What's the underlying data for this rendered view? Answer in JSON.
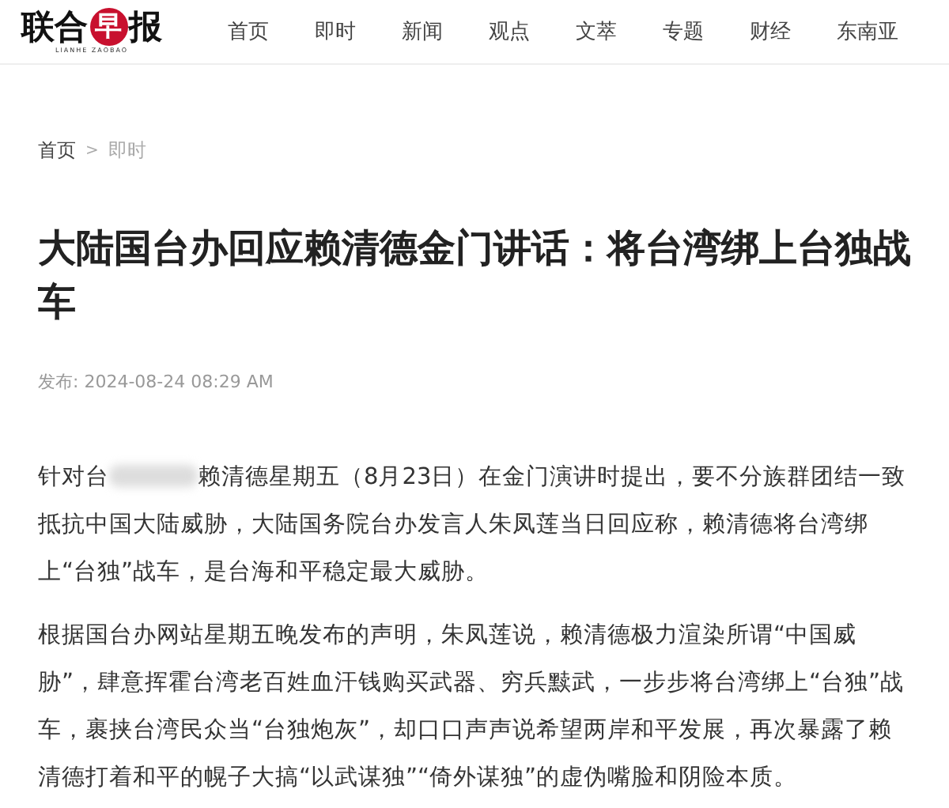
{
  "logo": {
    "chars": [
      "联",
      "合",
      "早",
      "报"
    ],
    "subtitle": "LIANHE ZAOBAO"
  },
  "nav": [
    {
      "label": "首页"
    },
    {
      "label": "即时"
    },
    {
      "label": "新闻"
    },
    {
      "label": "观点"
    },
    {
      "label": "文萃"
    },
    {
      "label": "专题"
    },
    {
      "label": "财经"
    },
    {
      "label": "东南亚"
    }
  ],
  "breadcrumb": [
    {
      "label": "首页",
      "current": false
    },
    {
      "label": "即时",
      "current": true
    }
  ],
  "breadcrumb_separator": ">",
  "title": "大陆国台办回应赖清德金门讲话：将台湾绑上台独战车",
  "published": "发布: 2024-08-24 08:29 AM",
  "paragraphs": [
    {
      "before_blur": "针对台",
      "after_blur": "赖清德星期五（8月23日）在金门演讲时提出，要不分族群团结一致抵抗中国大陆威胁，大陆国务院台办发言人朱凤莲当日回应称，赖清德将台湾绑上“台独”战车，是台海和平稳定最大威胁。"
    },
    {
      "text": "根据国台办网站星期五晚发布的声明，朱凤莲说，赖清德极力渲染所谓“中国威胁”，肆意挥霍台湾老百姓血汗钱购买武器、穷兵黩武，一步步将台湾绑上“台独”战车，裹挟台湾民众当“台独炮灰”，却口口声声说希望两岸和平发展，再次暴露了赖清德打着和平的幌子大搞“以武谋独”“倚外谋独”的虚伪嘴脸和阴险本质。"
    }
  ]
}
